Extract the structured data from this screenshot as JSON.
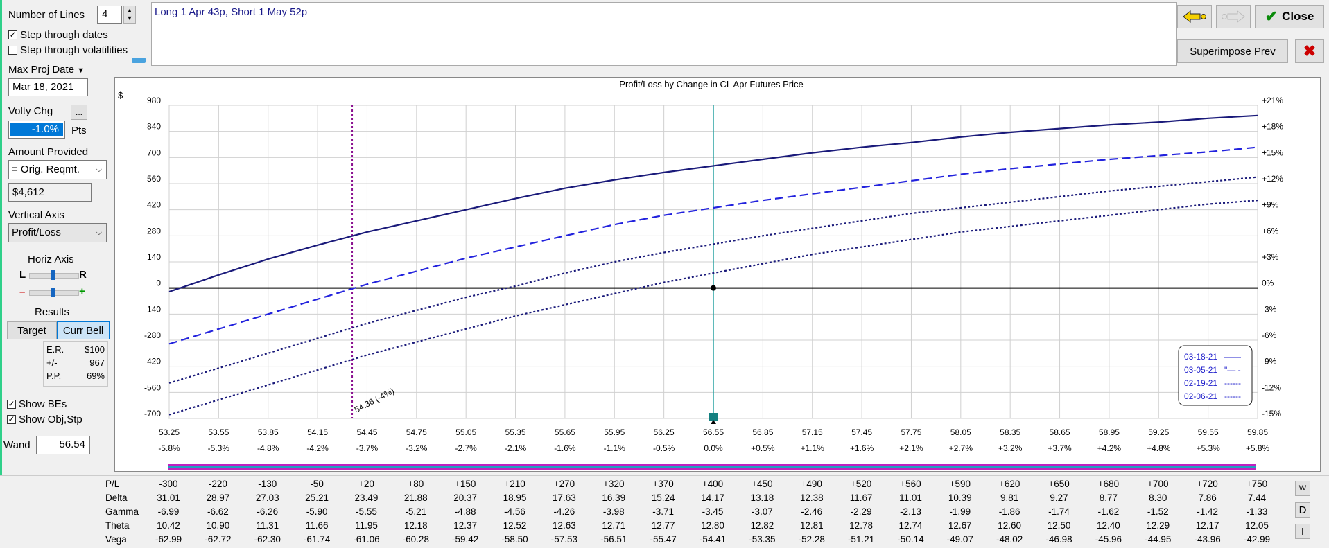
{
  "controls": {
    "number_of_lines_label": "Number of Lines",
    "number_of_lines": "4",
    "step_dates_label": "Step through dates",
    "step_dates_checked": true,
    "step_vols_label": "Step through volatilities",
    "step_vols_checked": false,
    "max_proj_date_label": "Max Proj Date",
    "max_proj_date": "Mar 18, 2021",
    "volty_chg_label": "Volty Chg",
    "volty_chg_value": "-1.0%",
    "volty_chg_unit": "Pts",
    "ellipsis": "...",
    "amount_provided_label": "Amount Provided",
    "amount_provided_option": "= Orig. Reqmt.",
    "amount_value": "$4,612",
    "vertical_axis_label": "Vertical Axis",
    "vertical_axis_option": "Profit/Loss",
    "horiz_axis_label": "Horiz Axis",
    "horiz_left": "L",
    "horiz_right": "R",
    "zoom_minus": "–",
    "zoom_plus": "+",
    "results_label": "Results",
    "target_button": "Target",
    "curr_bell_button": "Curr Bell",
    "results": [
      {
        "label": "E.R.",
        "value": "$100"
      },
      {
        "label": "+/-",
        "value": "967"
      },
      {
        "label": "P.P.",
        "value": "69%"
      }
    ],
    "show_bes_label": "Show BEs",
    "show_bes_checked": true,
    "show_obj_label": "Show Obj,Stp",
    "show_obj_checked": true,
    "wand_label": "Wand",
    "wand_value": "56.54"
  },
  "description": "Long 1 Apr 43p, Short 1 May 52p",
  "toolbar": {
    "close_label": "Close",
    "superimpose_label": "Superimpose Prev"
  },
  "chart_data": {
    "type": "line",
    "title": "Profit/Loss by Change in CL Apr Futures Price",
    "y_unit_label": "$",
    "ylim": [
      -700,
      980
    ],
    "xlim": [
      53.25,
      59.85
    ],
    "y_ticks": [
      "980",
      "840",
      "700",
      "560",
      "420",
      "280",
      "140",
      "0",
      "-140",
      "-280",
      "-420",
      "-560",
      "-700"
    ],
    "y2_ticks": [
      "+21%",
      "+18%",
      "+15%",
      "+12%",
      "+9%",
      "+6%",
      "+3%",
      "0%",
      "-3%",
      "-6%",
      "-9%",
      "-12%",
      "-15%"
    ],
    "x_ticks": [
      "53.25",
      "53.55",
      "53.85",
      "54.15",
      "54.45",
      "54.75",
      "55.05",
      "55.35",
      "55.65",
      "55.95",
      "56.25",
      "56.55",
      "56.85",
      "57.15",
      "57.45",
      "57.75",
      "58.05",
      "58.35",
      "58.65",
      "58.95",
      "59.25",
      "59.55",
      "59.85"
    ],
    "x_pct_ticks": [
      "-5.8%",
      "-5.3%",
      "-4.8%",
      "-4.2%",
      "-3.7%",
      "-3.2%",
      "-2.7%",
      "-2.1%",
      "-1.6%",
      "-1.1%",
      "-0.5%",
      "0.0%",
      "+0.5%",
      "+1.1%",
      "+1.6%",
      "+2.1%",
      "+2.7%",
      "+3.2%",
      "+3.7%",
      "+4.2%",
      "+4.8%",
      "+5.3%",
      "+5.8%"
    ],
    "grid": true,
    "current_price": 56.55,
    "breakeven": 54.36,
    "breakeven_label": "54.36 (-4%)",
    "legend_position": "bottom-right",
    "series": [
      {
        "name": "03-18-21",
        "legend_suffix": "——",
        "style": "solid",
        "color": "#1a1a7a",
        "x": [
          53.25,
          53.55,
          53.85,
          54.15,
          54.45,
          54.75,
          55.05,
          55.35,
          55.65,
          55.95,
          56.25,
          56.55,
          56.85,
          57.15,
          57.45,
          57.75,
          58.05,
          58.35,
          58.65,
          58.95,
          59.25,
          59.55,
          59.85
        ],
        "values": [
          -20,
          70,
          155,
          230,
          300,
          360,
          420,
          480,
          535,
          580,
          620,
          655,
          690,
          725,
          755,
          780,
          810,
          835,
          855,
          875,
          890,
          910,
          925
        ]
      },
      {
        "name": "03-05-21",
        "legend_suffix": "\"— -",
        "style": "dashed",
        "color": "#2222dd",
        "x": [
          53.25,
          53.55,
          53.85,
          54.15,
          54.45,
          54.75,
          55.05,
          55.35,
          55.65,
          55.95,
          56.25,
          56.55,
          56.85,
          57.15,
          57.45,
          57.75,
          58.05,
          58.35,
          58.65,
          58.95,
          59.25,
          59.55,
          59.85
        ],
        "values": [
          -300,
          -220,
          -140,
          -60,
          20,
          90,
          160,
          220,
          280,
          340,
          390,
          430,
          470,
          505,
          540,
          575,
          610,
          640,
          665,
          690,
          710,
          730,
          755
        ]
      },
      {
        "name": "02-19-21",
        "legend_suffix": "------",
        "style": "dotted",
        "color": "#1a1a7a",
        "x": [
          53.25,
          53.55,
          53.85,
          54.15,
          54.45,
          54.75,
          55.05,
          55.35,
          55.65,
          55.95,
          56.25,
          56.55,
          56.85,
          57.15,
          57.45,
          57.75,
          58.05,
          58.35,
          58.65,
          58.95,
          59.25,
          59.55,
          59.85
        ],
        "values": [
          -510,
          -430,
          -350,
          -270,
          -190,
          -120,
          -50,
          10,
          80,
          140,
          190,
          235,
          280,
          320,
          360,
          400,
          430,
          460,
          490,
          520,
          545,
          570,
          595
        ]
      },
      {
        "name": "02-06-21",
        "legend_suffix": "------",
        "style": "dotted",
        "color": "#1a1a7a",
        "x": [
          53.25,
          53.55,
          53.85,
          54.15,
          54.45,
          54.75,
          55.05,
          55.35,
          55.65,
          55.95,
          56.25,
          56.55,
          56.85,
          57.15,
          57.45,
          57.75,
          58.05,
          58.35,
          58.65,
          58.95,
          59.25,
          59.55,
          59.85
        ],
        "values": [
          -680,
          -600,
          -520,
          -440,
          -360,
          -290,
          -220,
          -150,
          -90,
          -30,
          30,
          80,
          130,
          180,
          220,
          260,
          300,
          330,
          360,
          390,
          420,
          450,
          470
        ]
      }
    ]
  },
  "table": {
    "rows": [
      {
        "label": "P/L",
        "values": [
          "-300",
          "-220",
          "-130",
          "-50",
          "+20",
          "+80",
          "+150",
          "+210",
          "+270",
          "+320",
          "+370",
          "+400",
          "+450",
          "+490",
          "+520",
          "+560",
          "+590",
          "+620",
          "+650",
          "+680",
          "+700",
          "+720",
          "+750"
        ]
      },
      {
        "label": "Delta",
        "values": [
          "31.01",
          "28.97",
          "27.03",
          "25.21",
          "23.49",
          "21.88",
          "20.37",
          "18.95",
          "17.63",
          "16.39",
          "15.24",
          "14.17",
          "13.18",
          "12.38",
          "11.67",
          "11.01",
          "10.39",
          "9.81",
          "9.27",
          "8.77",
          "8.30",
          "7.86",
          "7.44"
        ]
      },
      {
        "label": "Gamma",
        "values": [
          "-6.99",
          "-6.62",
          "-6.26",
          "-5.90",
          "-5.55",
          "-5.21",
          "-4.88",
          "-4.56",
          "-4.26",
          "-3.98",
          "-3.71",
          "-3.45",
          "-3.07",
          "-2.46",
          "-2.29",
          "-2.13",
          "-1.99",
          "-1.86",
          "-1.74",
          "-1.62",
          "-1.52",
          "-1.42",
          "-1.33"
        ]
      },
      {
        "label": "Theta",
        "values": [
          "10.42",
          "10.90",
          "11.31",
          "11.66",
          "11.95",
          "12.18",
          "12.37",
          "12.52",
          "12.63",
          "12.71",
          "12.77",
          "12.80",
          "12.82",
          "12.81",
          "12.78",
          "12.74",
          "12.67",
          "12.60",
          "12.50",
          "12.40",
          "12.29",
          "12.17",
          "12.05"
        ]
      },
      {
        "label": "Vega",
        "values": [
          "-62.99",
          "-62.72",
          "-62.30",
          "-61.74",
          "-61.06",
          "-60.28",
          "-59.42",
          "-58.50",
          "-57.53",
          "-56.51",
          "-55.47",
          "-54.41",
          "-53.35",
          "-52.28",
          "-51.21",
          "-50.14",
          "-49.07",
          "-48.02",
          "-46.98",
          "-45.96",
          "-44.95",
          "-43.96",
          "-42.99"
        ]
      }
    ],
    "side_buttons": [
      "W",
      "D",
      "I"
    ]
  }
}
